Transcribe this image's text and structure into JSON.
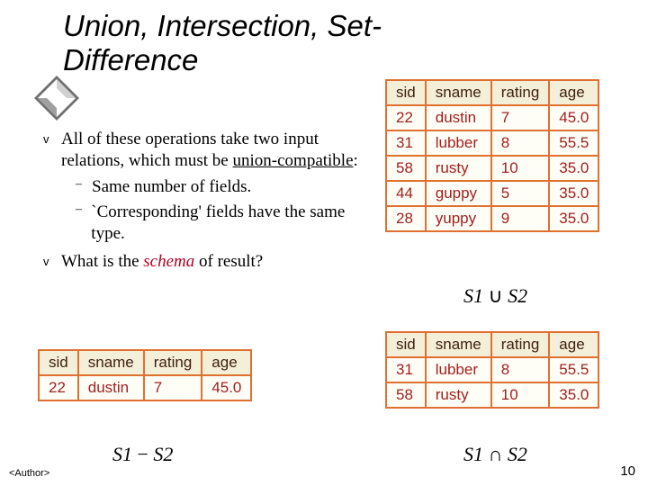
{
  "title": "Union, Intersection, Set-Difference",
  "bullets": {
    "item1_pre": "All of these operations take two input relations, which must be ",
    "item1_under": "union-compatible",
    "item1_post": ":",
    "sub1": "Same number of fields.",
    "sub2": "`Corresponding' fields have the same type.",
    "item2_pre": "What is the ",
    "item2_em": "schema",
    "item2_post": " of result?"
  },
  "tables": {
    "headers": [
      "sid",
      "sname",
      "rating",
      "age"
    ],
    "union": [
      [
        "22",
        "dustin",
        "7",
        "45.0"
      ],
      [
        "31",
        "lubber",
        "8",
        "55.5"
      ],
      [
        "58",
        "rusty",
        "10",
        "35.0"
      ],
      [
        "44",
        "guppy",
        "5",
        "35.0"
      ],
      [
        "28",
        "yuppy",
        "9",
        "35.0"
      ]
    ],
    "intersect": [
      [
        "31",
        "lubber",
        "8",
        "55.5"
      ],
      [
        "58",
        "rusty",
        "10",
        "35.0"
      ]
    ],
    "diff": [
      [
        "22",
        "dustin",
        "7",
        "45.0"
      ]
    ]
  },
  "formulas": {
    "union": "S1 ∪ S2",
    "intersect": "S1 ∩ S2",
    "diff": "S1 − S2"
  },
  "footer": "<Author>",
  "page": "10"
}
